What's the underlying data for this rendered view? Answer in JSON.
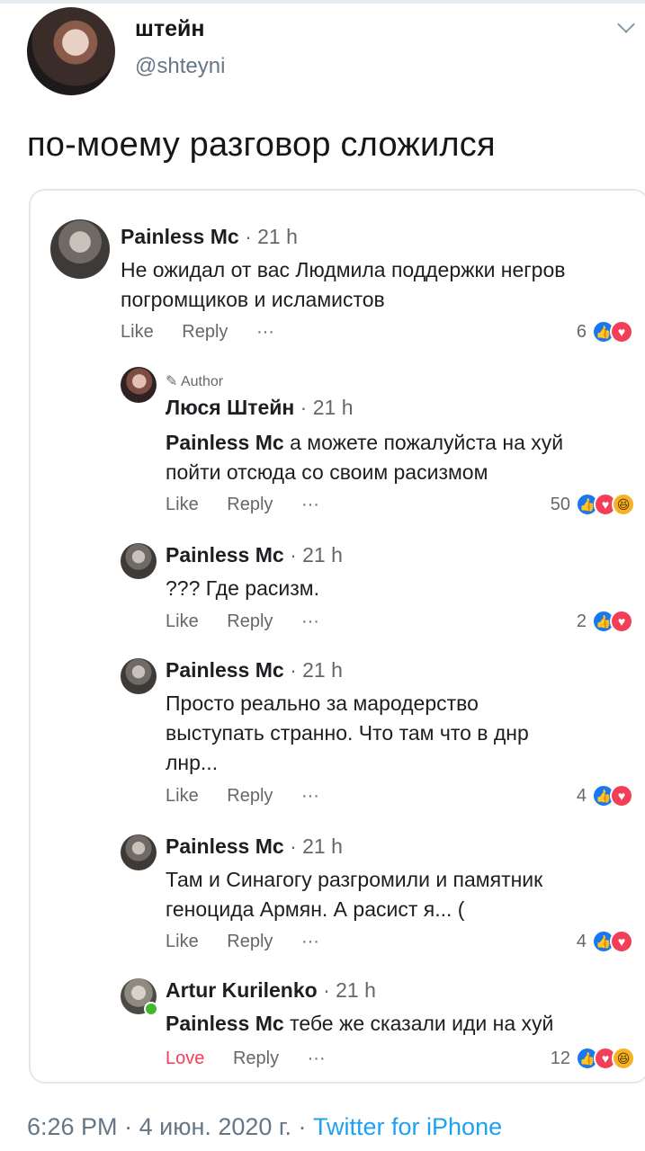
{
  "tweet": {
    "name": "штейн",
    "handle": "@shteyni",
    "text": "по-моему разговор сложился",
    "time": "6:26 PM",
    "date": "4 июн. 2020 г.",
    "separator": "·",
    "source": "Twitter for iPhone"
  },
  "actions": {
    "like": "Like",
    "reply": "Reply",
    "more": "···",
    "love": "Love"
  },
  "comments": [
    {
      "name": "Painless Mc",
      "time": "21 h",
      "text": "Не ожидал от вас Людмила поддержки негров\nпогромщиков и исламистов",
      "count": "6"
    },
    {
      "badge": "Author",
      "name": "Люся Штейн",
      "time": "21 h",
      "mention": "Painless Mc",
      "text": " а можете пожалуйста на хуй\nпойти отсюда со своим расизмом",
      "count": "50"
    },
    {
      "name": "Painless Mc",
      "time": "21 h",
      "text": "??? Где расизм.",
      "count": "2"
    },
    {
      "name": "Painless Mc",
      "time": "21 h",
      "text": "Просто реально за мародерство\nвыступать странно. Что там что в днр\nлнр...",
      "count": "4"
    },
    {
      "name": "Painless Mc",
      "time": "21 h",
      "text": "Там и Синагогу разгромили и памятник\nгеноцида Армян. А расист я... (",
      "count": "4"
    },
    {
      "name": "Artur Kurilenko",
      "time": "21 h",
      "mention": "Painless Mc",
      "text": " тебе же сказали иди на хуй",
      "count": "12"
    }
  ]
}
